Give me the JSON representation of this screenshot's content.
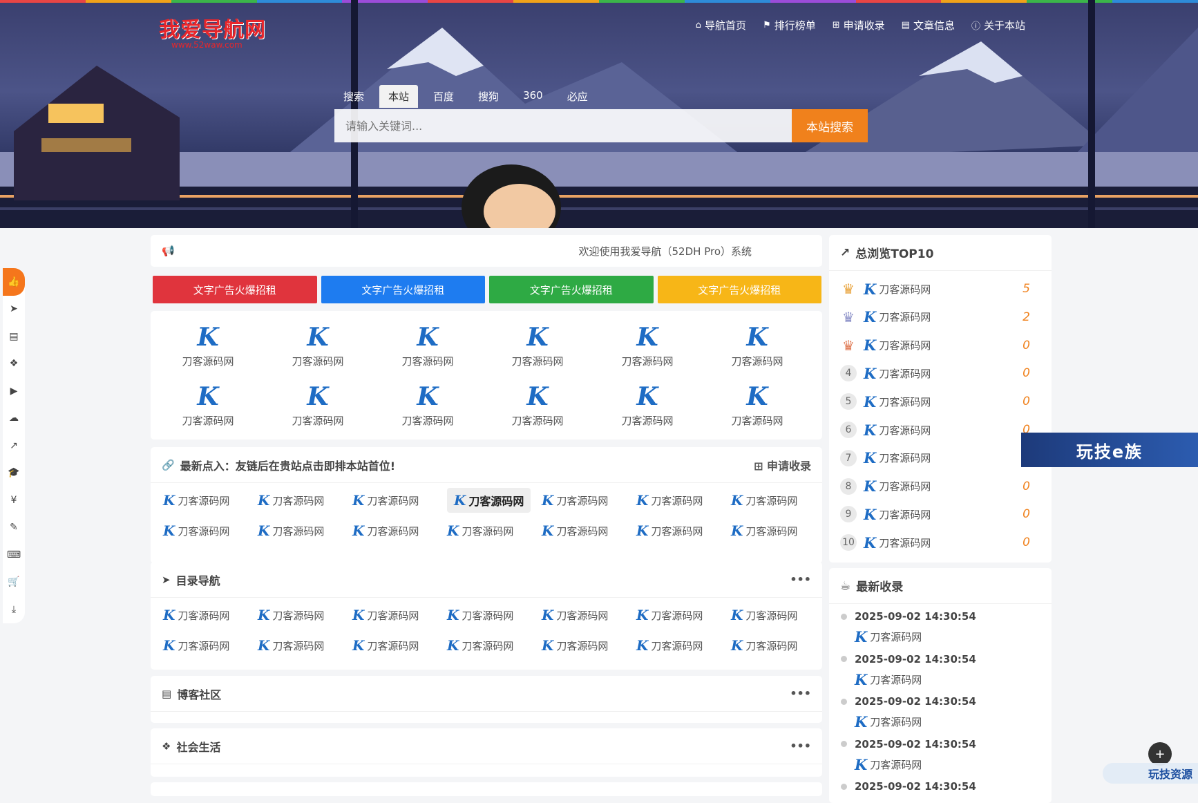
{
  "header": {
    "logo_title": "我爱导航网",
    "logo_url": "www.52waw.com",
    "nav": [
      {
        "icon": "home-icon",
        "glyph": "⌂",
        "label": "导航首页"
      },
      {
        "icon": "flag-icon",
        "glyph": "⚑",
        "label": "排行榜单"
      },
      {
        "icon": "plus-square-icon",
        "glyph": "⊞",
        "label": "申请收录"
      },
      {
        "icon": "book-icon",
        "glyph": "▤",
        "label": "文章信息"
      },
      {
        "icon": "info-icon",
        "glyph": "ⓘ",
        "label": "关于本站"
      }
    ],
    "accent_bar_colors": [
      "#e84545",
      "#f0a21a",
      "#3bb54a",
      "#2e8bd9",
      "#9b4cd9",
      "#e84545",
      "#f0a21a",
      "#3bb54a",
      "#2e8bd9",
      "#9b4cd9",
      "#e84545",
      "#f0a21a",
      "#3bb54a",
      "#2e8bd9"
    ]
  },
  "search": {
    "tabs": [
      "搜索",
      "本站",
      "百度",
      "搜狗",
      "360",
      "必应"
    ],
    "active_tab": "本站",
    "placeholder": "请输入关键词...",
    "button": "本站搜索"
  },
  "sidebar_icons": [
    "thumbs-up-icon",
    "paper-plane-icon",
    "file-icon",
    "cubes-icon",
    "youtube-icon",
    "cloud-icon",
    "chart-line-icon",
    "graduation-cap-icon",
    "yen-icon",
    "wrench-icon",
    "keyboard-icon",
    "cart-icon",
    "download-icon"
  ],
  "sidebar_glyphs": [
    "👍",
    "➤",
    "▤",
    "❖",
    "▶",
    "☁",
    "↗",
    "🎓",
    "¥",
    "✎",
    "⌨",
    "🛒",
    "⤓"
  ],
  "notice": {
    "text": "欢迎使用我爱导航（52DH Pro）系统"
  },
  "ads": [
    {
      "label": "文字广告火爆招租",
      "color": "#e0343d"
    },
    {
      "label": "文字广告火爆招租",
      "color": "#1e7cf0"
    },
    {
      "label": "文字广告火爆招租",
      "color": "#2eaa44"
    },
    {
      "label": "文字广告火爆招租",
      "color": "#f7b617"
    }
  ],
  "featured_sites": [
    "刀客源码网",
    "刀客源码网",
    "刀客源码网",
    "刀客源码网",
    "刀客源码网",
    "刀客源码网",
    "刀客源码网",
    "刀客源码网",
    "刀客源码网",
    "刀客源码网",
    "刀客源码网",
    "刀客源码网"
  ],
  "site_logo_glyph": "K",
  "friend_links": {
    "title": "最新点入：友链后在贵站点击即排本站首位!",
    "apply": "申请收录",
    "items": [
      "刀客源码网",
      "刀客源码网",
      "刀客源码网",
      "刀客源码网",
      "刀客源码网",
      "刀客源码网",
      "刀客源码网",
      "刀客源码网",
      "刀客源码网",
      "刀客源码网",
      "刀客源码网",
      "刀客源码网",
      "刀客源码网",
      "刀客源码网"
    ]
  },
  "catalog": {
    "title": "目录导航",
    "more": "•••",
    "items": [
      "刀客源码网",
      "刀客源码网",
      "刀客源码网",
      "刀客源码网",
      "刀客源码网",
      "刀客源码网",
      "刀客源码网",
      "刀客源码网",
      "刀客源码网",
      "刀客源码网",
      "刀客源码网",
      "刀客源码网",
      "刀客源码网",
      "刀客源码网"
    ]
  },
  "blog": {
    "title": "博客社区",
    "more": "•••"
  },
  "social": {
    "title": "社会生活",
    "more": "•••"
  },
  "top10": {
    "title": "总浏览TOP10",
    "items": [
      {
        "rank": "1",
        "name": "刀客源码网",
        "count": "5"
      },
      {
        "rank": "2",
        "name": "刀客源码网",
        "count": "2"
      },
      {
        "rank": "3",
        "name": "刀客源码网",
        "count": "0"
      },
      {
        "rank": "4",
        "name": "刀客源码网",
        "count": "0"
      },
      {
        "rank": "5",
        "name": "刀客源码网",
        "count": "0"
      },
      {
        "rank": "6",
        "name": "刀客源码网",
        "count": "0"
      },
      {
        "rank": "7",
        "name": "刀客源码网",
        "count": ""
      },
      {
        "rank": "8",
        "name": "刀客源码网",
        "count": "0"
      },
      {
        "rank": "9",
        "name": "刀客源码网",
        "count": "0"
      },
      {
        "rank": "10",
        "name": "刀客源码网",
        "count": "0"
      }
    ]
  },
  "latest": {
    "title": "最新收录",
    "items": [
      {
        "time": "2025-09-02 14:30:54",
        "name": "刀客源码网"
      },
      {
        "time": "2025-09-02 14:30:54",
        "name": "刀客源码网"
      },
      {
        "time": "2025-09-02 14:30:54",
        "name": "刀客源码网"
      },
      {
        "time": "2025-09-02 14:30:54",
        "name": "刀客源码网"
      },
      {
        "time": "2025-09-02 14:30:54",
        "name": ""
      }
    ]
  },
  "float_banner": "玩技e族",
  "watermark": "玩技资源"
}
